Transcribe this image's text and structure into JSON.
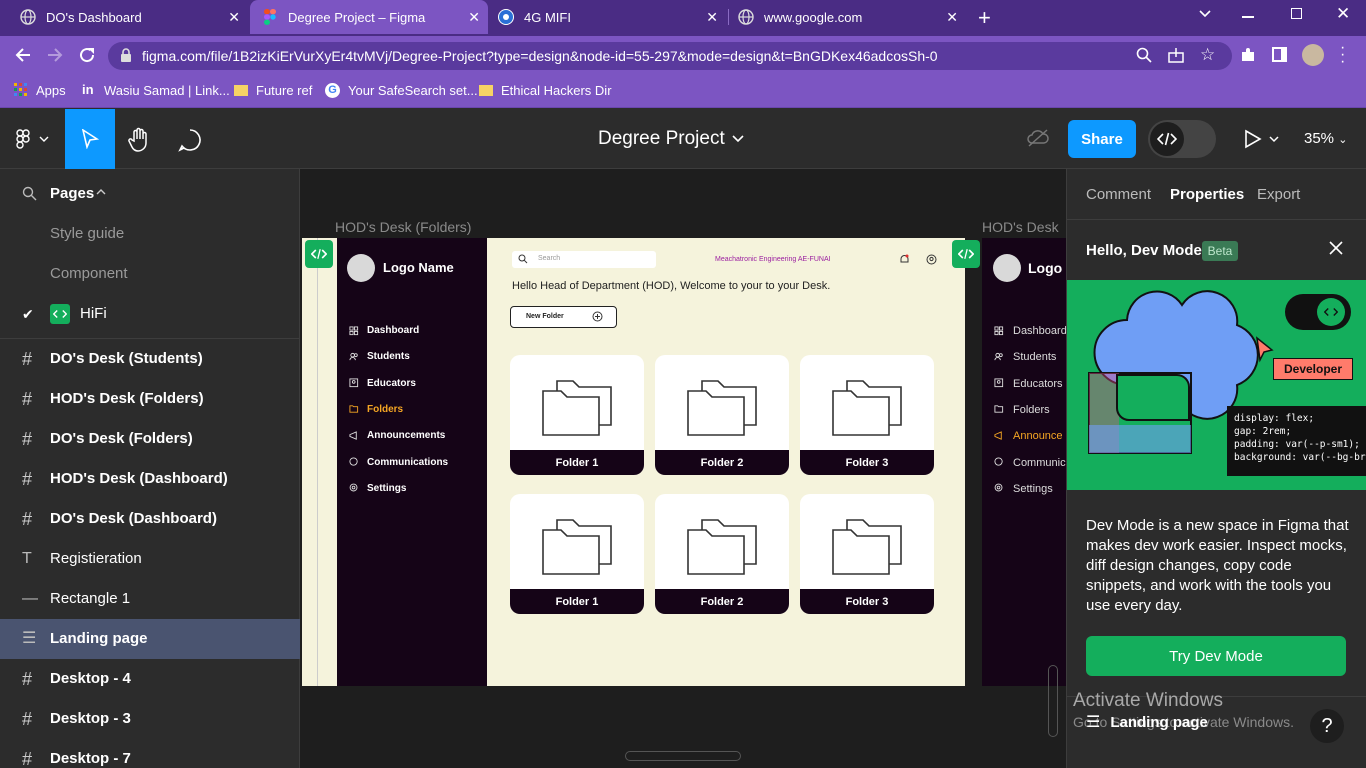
{
  "browser": {
    "tabs": [
      {
        "title": "DO's Dashboard",
        "favicon": "globe-icon"
      },
      {
        "title": "Degree Project – Figma",
        "favicon": "figma-icon"
      },
      {
        "title": "4G MIFI",
        "favicon": "chrome-icon"
      },
      {
        "title": "www.google.com",
        "favicon": "globe-icon"
      }
    ],
    "url": "figma.com/file/1B2izKiErVurXyEr4tvMVj/Degree-Project?type=design&node-id=55-297&mode=design&t=BnGDKex46adcosSh-0",
    "bookmarks": [
      "Apps",
      "Wasiu Samad | Link...",
      "Future ref",
      "Your SafeSearch set...",
      "Ethical Hackers Dir"
    ]
  },
  "figma": {
    "file_name": "Degree Project",
    "share_label": "Share",
    "zoom": "35%",
    "pages_label": "Pages",
    "pages": [
      "Style guide",
      "Component",
      "HiFi"
    ],
    "layers": [
      {
        "name": "DO's Desk (Students)",
        "icon": "frame-icon"
      },
      {
        "name": "HOD's Desk (Folders)",
        "icon": "frame-icon"
      },
      {
        "name": "DO's Desk (Folders)",
        "icon": "frame-icon"
      },
      {
        "name": "HOD's Desk (Dashboard)",
        "icon": "frame-icon"
      },
      {
        "name": "DO's Desk (Dashboard)",
        "icon": "frame-icon"
      },
      {
        "name": "Registieration",
        "icon": "text-icon"
      },
      {
        "name": "Rectangle 1",
        "icon": "line-icon"
      },
      {
        "name": "Landing page",
        "icon": "section-icon"
      },
      {
        "name": "Desktop - 4",
        "icon": "frame-icon"
      },
      {
        "name": "Desktop - 3",
        "icon": "frame-icon"
      },
      {
        "name": "Desktop - 7",
        "icon": "frame-icon"
      }
    ],
    "right_tabs": [
      "Comment",
      "Properties",
      "Export"
    ],
    "devmode": {
      "title": "Hello, Dev Mode",
      "beta": "Beta",
      "developer_tag": "Developer",
      "code_lines": [
        "display: flex;",
        "gap: 2rem;",
        "padding: var(--p-sm1);",
        "background: var(--bg-bra"
      ],
      "description": "Dev Mode is a new space in Figma that makes dev work easier. Inspect mocks, diff design changes, copy code snippets, and work with the tools you use every day.",
      "button": "Try Dev Mode"
    },
    "activate_windows": "Activate Windows",
    "activate_windows_sub": "Go to Settings to activate Windows.",
    "tooltip": "Landing page",
    "help": "?"
  },
  "canvas": {
    "frame1_label": "HOD's Desk (Folders)",
    "frame2_label": "HOD's Desk (",
    "frame1": {
      "logo": "Logo Name",
      "nav": [
        "Dashboard",
        "Students",
        "Educators",
        "Folders",
        "Announcements",
        "Communications",
        "Settings"
      ],
      "active_nav": "Folders",
      "search_placeholder": "Search",
      "department": "Meachatronic Engineering AE-FUNAI",
      "welcome": "Hello Head of Department (HOD), Welcome to your to your Desk.",
      "new_folder": "New Folder",
      "folders_row1": [
        "Folder 1",
        "Folder 2",
        "Folder 3"
      ],
      "folders_row2": [
        "Folder 1",
        "Folder 2",
        "Folder 3"
      ]
    },
    "frame2": {
      "logo": "Logo",
      "nav": [
        "Dashboard",
        "Students",
        "Educators",
        "Folders",
        "Announce",
        "Communic",
        "Settings"
      ]
    }
  },
  "colors": {
    "accent": "#0d99ff",
    "dev_green": "#14ae5c",
    "sidebar_dark": "#150417",
    "frame_bg": "#f5f3dc",
    "active_nav": "#f5a623"
  }
}
